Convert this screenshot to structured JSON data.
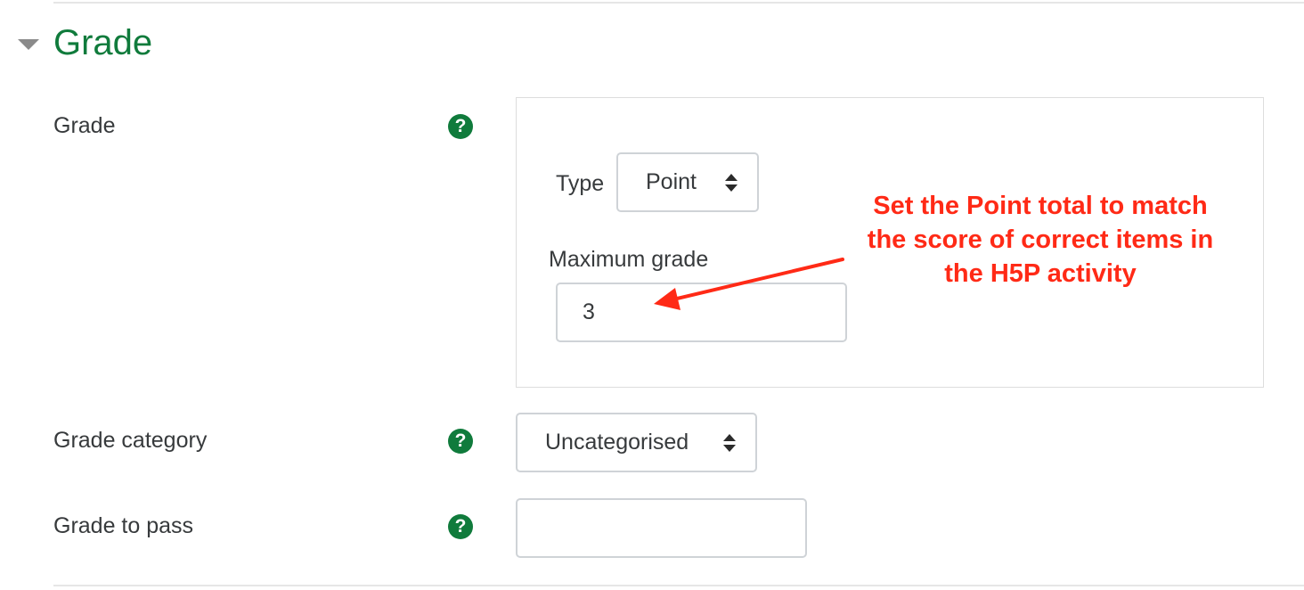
{
  "section": {
    "title": "Grade"
  },
  "rows": {
    "grade": {
      "label": "Grade"
    },
    "grade_category": {
      "label": "Grade category"
    },
    "grade_to_pass": {
      "label": "Grade to pass",
      "value": ""
    }
  },
  "grade_box": {
    "type_label": "Type",
    "type_value": "Point",
    "max_grade_label": "Maximum grade",
    "max_grade_value": "3"
  },
  "category_select": {
    "value": "Uncategorised"
  },
  "help_icon_glyph": "?",
  "annotation": {
    "text": "Set the Point total to match the score of correct items in the H5P activity"
  },
  "icons": {
    "collapse": "triangle-down-icon",
    "help": "question-circle-icon",
    "select": "updown-icon",
    "annotation_arrow": "arrow-icon"
  },
  "colors": {
    "accent": "#107b3c",
    "annotation": "#ff2a16",
    "border": "#cfd3d7"
  }
}
